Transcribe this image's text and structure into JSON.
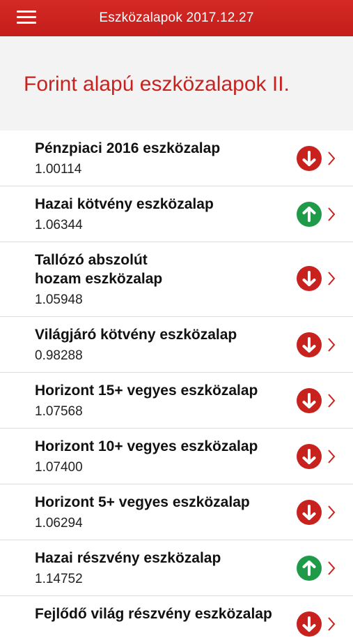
{
  "header": {
    "title": "Eszközalapok 2017.12.27",
    "menu_icon": "hamburger-menu-icon"
  },
  "section": {
    "title": "Forint alapú eszközalapok II."
  },
  "colors": {
    "brand_red": "#c8221f",
    "down": "#c8221f",
    "up": "#1f9a48",
    "chevron": "#c8221f"
  },
  "funds": [
    {
      "name": "Pénzpiaci 2016 eszközalap",
      "value": "1.00114",
      "trend": "down"
    },
    {
      "name": "Hazai kötvény eszközalap",
      "value": "1.06344",
      "trend": "up"
    },
    {
      "name": "Tallózó abszolút\nhozam eszközalap",
      "value": "1.05948",
      "trend": "down"
    },
    {
      "name": "Világjáró kötvény eszközalap",
      "value": "0.98288",
      "trend": "down"
    },
    {
      "name": "Horizont 15+ vegyes eszközalap",
      "value": "1.07568",
      "trend": "down"
    },
    {
      "name": "Horizont 10+ vegyes eszközalap",
      "value": "1.07400",
      "trend": "down"
    },
    {
      "name": "Horizont 5+ vegyes eszközalap",
      "value": "1.06294",
      "trend": "down"
    },
    {
      "name": "Hazai részvény eszközalap",
      "value": "1.14752",
      "trend": "up"
    },
    {
      "name": "Fejlődő világ részvény eszközalap",
      "value": "",
      "trend": "down"
    }
  ]
}
